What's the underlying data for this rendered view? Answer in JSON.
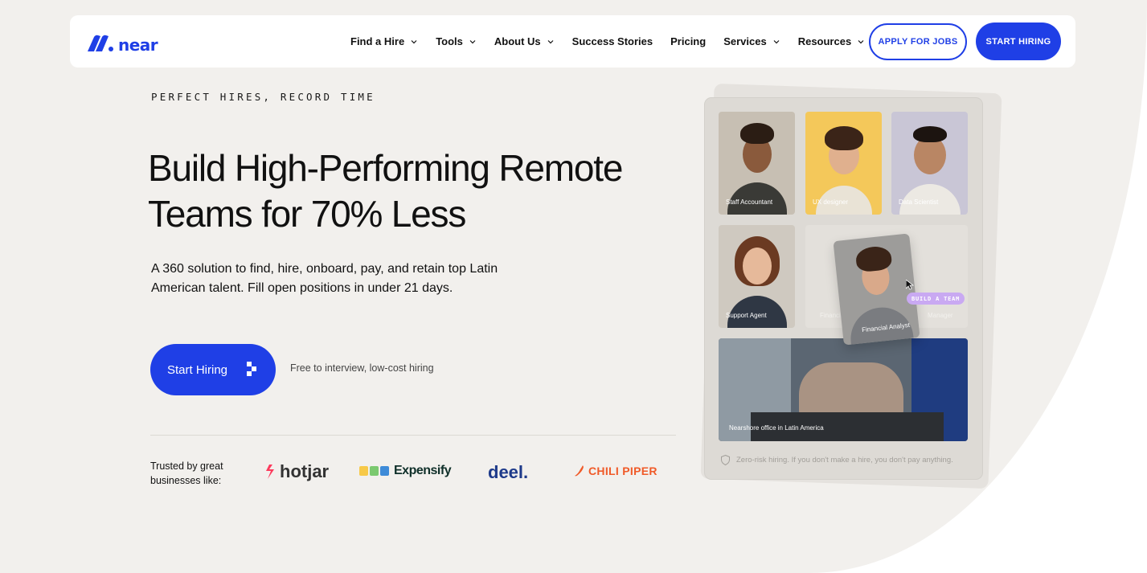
{
  "brand": {
    "logo_text": "near",
    "accent": "#1f3fe6"
  },
  "nav": {
    "items": [
      {
        "label": "Find a Hire",
        "has_dropdown": true
      },
      {
        "label": "Tools",
        "has_dropdown": true
      },
      {
        "label": "About Us",
        "has_dropdown": true
      },
      {
        "label": "Success Stories",
        "has_dropdown": false
      },
      {
        "label": "Pricing",
        "has_dropdown": false
      },
      {
        "label": "Services",
        "has_dropdown": true
      },
      {
        "label": "Resources",
        "has_dropdown": true
      }
    ],
    "apply_label": "APPLY FOR JOBS",
    "start_label": "START HIRING"
  },
  "hero": {
    "eyebrow": "PERFECT HIRES, RECORD TIME",
    "headline_line1": "Build High-Performing Remote",
    "headline_line2": "Teams for 70% Less",
    "subtext": "A 360 solution to find, hire, onboard, pay, and retain top Latin American talent. Fill open positions in under 21 days.",
    "cta_label": "Start Hiring",
    "cta_note": "Free to interview, low-cost hiring"
  },
  "trusted": {
    "label": "Trusted by great businesses like:",
    "logos": [
      "hotjar",
      "Expensify",
      "deel.",
      "CHILI PIPER"
    ]
  },
  "card": {
    "tiles": [
      {
        "label": "Staff Accountant"
      },
      {
        "label": "UX designer"
      },
      {
        "label": "Data Scientist"
      },
      {
        "label": "Support Agent"
      },
      {
        "label": "Financial"
      },
      {
        "label": "Manager"
      },
      {
        "label": "Nearshore office in Latin America"
      }
    ],
    "float_label": "Financial Analyst",
    "badge": "BUILD A TEAM",
    "note": "Zero-risk hiring. If you don't make a hire, you don't pay anything."
  }
}
